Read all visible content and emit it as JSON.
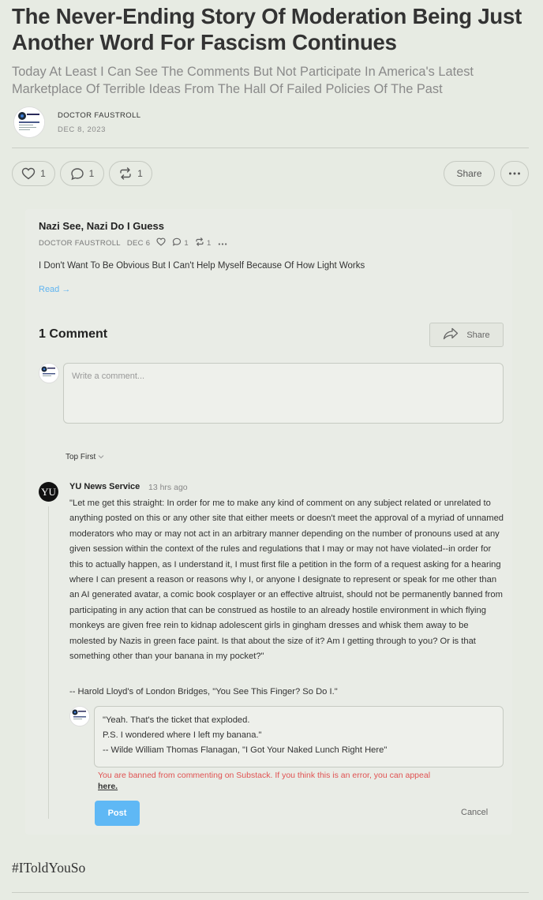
{
  "article": {
    "title": "The Never-Ending Story Of Moderation Being Just Another Word For Fascism Continues",
    "subtitle": "Today At Least I Can See The Comments But Not Participate In America's Latest Marketplace Of Terrible Ideas From The Hall Of Failed Policies Of The Past",
    "author": "DOCTOR FAUSTROLL",
    "date": "DEC 8, 2023",
    "hashtag": "#IToldYouSo"
  },
  "actions": {
    "like_count": "1",
    "comment_count": "1",
    "restack_count": "1",
    "share_label": "Share"
  },
  "embed": {
    "post_title": "Nazi See, Nazi Do I Guess",
    "author": "DOCTOR FAUSTROLL",
    "date": "DEC 6",
    "comment_count": "1",
    "restack_count": "1",
    "subtitle": "I Don't Want To Be Obvious But I Can't Help Myself Because Of How Light Works",
    "read_label": "Read →",
    "comments_heading": "1 Comment",
    "share_label": "Share",
    "comment_placeholder": "Write a comment...",
    "sort_label": "Top First"
  },
  "comment": {
    "avatar_text": "YU",
    "author": "YU News Service",
    "time": "13 hrs ago",
    "body": "\"Let me get this straight: In order for me to make any kind of comment on any subject related or unrelated to anything posted on this or any other site that either meets or doesn't meet the approval of a myriad of unnamed moderators who may or may not act in an arbitrary manner depending on the number of pronouns used at any given session within the context of the rules and regulations that I may or may not have violated--in order for this to actually happen, as I understand it, I must first file a petition in the form of a request asking for a hearing where I can present a reason or reasons why I, or anyone I designate to represent or speak for me other than an AI generated avatar, a comic book cosplayer or an effective altruist, should not be permanently banned from participating in any action that can be construed as hostile to an already hostile environment in which flying monkeys are given free rein to kidnap adolescent girls in gingham dresses and whisk them away to be molested by Nazis in green face paint. Is that about the size of it? Am I getting through to you? Or is that something other than your banana in my pocket?\"",
    "signature": "-- Harold Lloyd's of London Bridges, \"You See This Finger? So Do I.\""
  },
  "reply": {
    "line1": "\"Yeah. That's the ticket that exploded.",
    "line2": "P.S. I wondered where I left my banana.\"",
    "line3": "-- Wilde William Thomas Flanagan, \"I Got Your Naked Lunch Right Here\"",
    "ban_message": "You are banned from commenting on Substack. If you think this is an error, you can appeal",
    "ban_link": "here.",
    "post_label": "Post",
    "cancel_label": "Cancel"
  }
}
